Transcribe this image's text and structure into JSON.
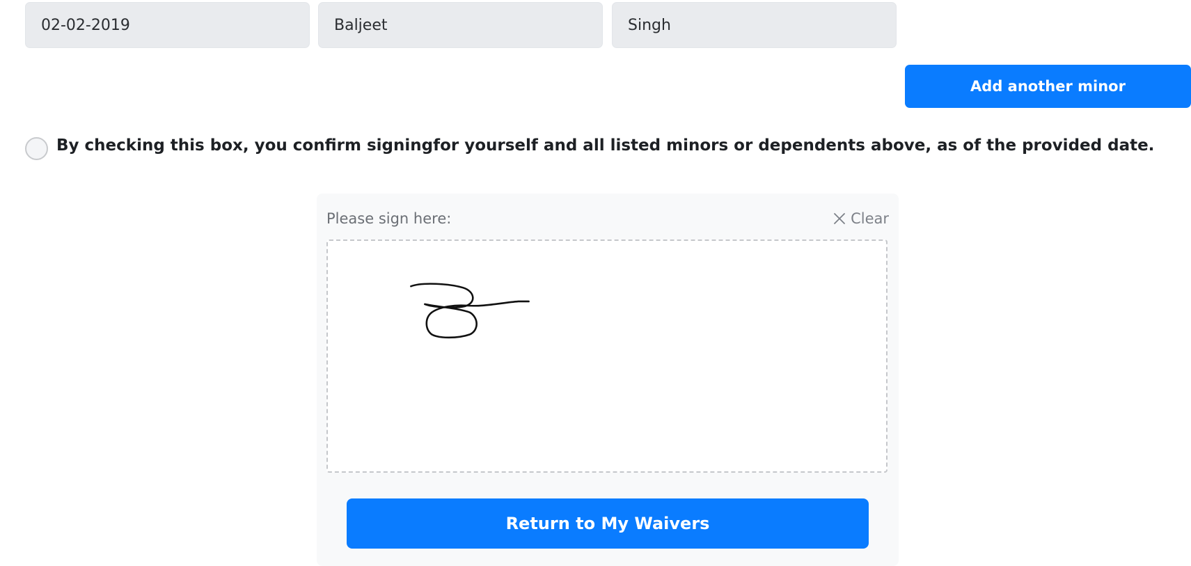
{
  "minor_fields": {
    "date_of_birth": "02-02-2019",
    "first_name": "Baljeet",
    "last_name": "Singh"
  },
  "add_minor_button": "Add another minor",
  "confirm": {
    "checked": false,
    "text": "By checking this box, you confirm signingfor yourself and all listed minors or dependents above, as of the provided date."
  },
  "signature": {
    "label": "Please sign here:",
    "clear_label": "Clear",
    "clear_icon": "close-icon",
    "has_signature": true
  },
  "return_button": "Return to My Waivers",
  "colors": {
    "primary": "#0a7cff",
    "field_background": "#e9ebee",
    "panel_background": "#f8f9fa"
  }
}
